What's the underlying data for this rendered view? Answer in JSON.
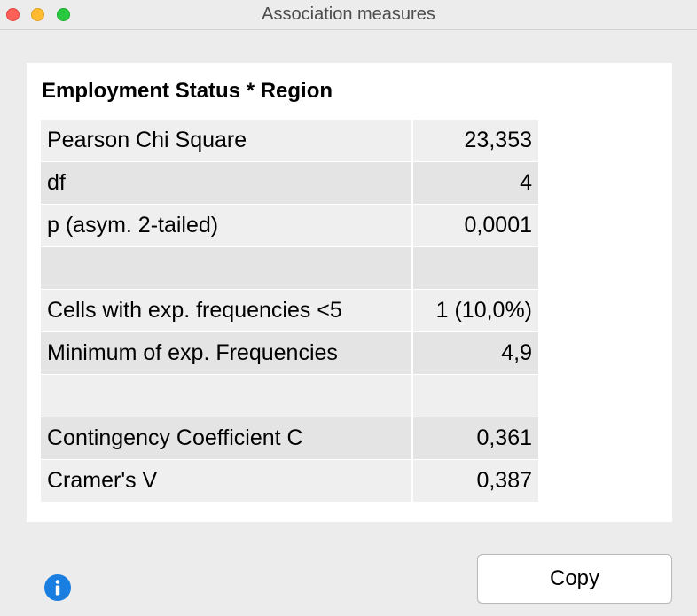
{
  "window": {
    "title": "Association measures"
  },
  "table": {
    "title": "Employment Status * Region",
    "rows": [
      {
        "label": "Pearson Chi Square",
        "value": "23,353"
      },
      {
        "label": "df",
        "value": "4"
      },
      {
        "label": "p (asym. 2-tailed)",
        "value": "0,0001"
      },
      {
        "label": "",
        "value": ""
      },
      {
        "label": "Cells with exp. frequencies <5",
        "value": "1 (10,0%)"
      },
      {
        "label": "Minimum of exp. Frequencies",
        "value": "4,9"
      },
      {
        "label": "",
        "value": ""
      },
      {
        "label": "Contingency Coefficient C",
        "value": "0,361"
      },
      {
        "label": "Cramer's V",
        "value": "0,387"
      }
    ]
  },
  "footer": {
    "info_icon": "info-icon",
    "copy_label": "Copy"
  },
  "colors": {
    "row_light": "#efefef",
    "row_dark": "#e4e4e4",
    "info_blue": "#1a7ee0"
  }
}
